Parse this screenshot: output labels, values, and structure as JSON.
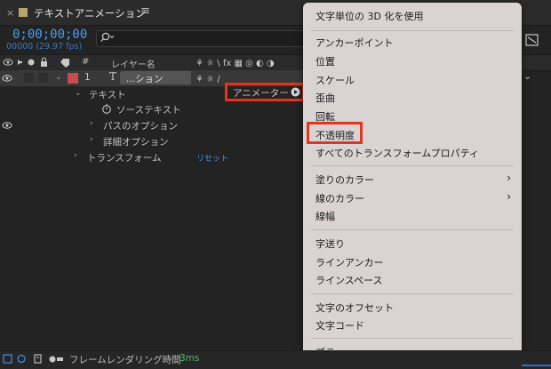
{
  "panel": {
    "close": "×",
    "title": "テキストアニメーション",
    "menu_icon": "≡",
    "timecode": "0;00;00;00",
    "fps": "00000 (29.97 fps)",
    "search_placeholder": ""
  },
  "columns": {
    "number": "#",
    "layer_name": "レイヤー名"
  },
  "layer": {
    "index": "1",
    "type_icon": "T",
    "name": "...ション",
    "color": "#c94b4b"
  },
  "tree": {
    "text_group": "テキスト",
    "source_text": "ソーステキスト",
    "path_options": "パスのオプション",
    "more_options": "詳細オプション",
    "transform": "トランスフォーム",
    "reset": "リセット",
    "animator": "アニメーター :"
  },
  "context_menu": {
    "items": [
      "文字単位の 3D 化を使用",
      "アンカーポイント",
      "位置",
      "スケール",
      "歪曲",
      "回転",
      "不透明度",
      "すべてのトランスフォームプロパティ",
      "塗りのカラー",
      "線のカラー",
      "線幅",
      "字送り",
      "ラインアンカー",
      "ラインスペース",
      "文字のオフセット",
      "文字コード",
      "ブラー"
    ],
    "highlighted": "不透明度"
  },
  "footer": {
    "render_label": "フレームレンダリング時間",
    "render_value": "3ms"
  },
  "colors": {
    "accent_blue": "#4a9ef6",
    "highlight_red": "#e8331b",
    "render_green": "#4fbf6b"
  }
}
